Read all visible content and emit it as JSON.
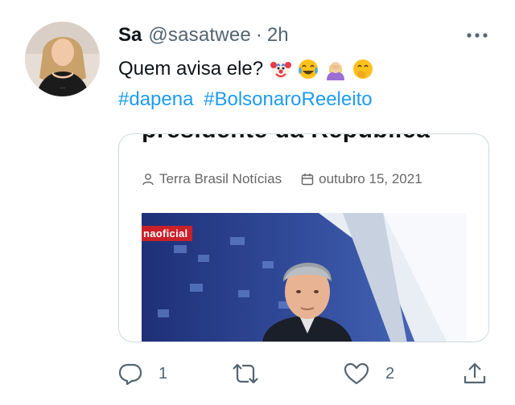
{
  "tweet": {
    "author_name": "Sa",
    "handle": "@sasatwee",
    "separator": "·",
    "time": "2h",
    "text": "Quem avisa ele?",
    "emojis": [
      "clown-face",
      "face-with-tears-of-joy",
      "person-facepalming",
      "face-with-hand-over-mouth"
    ],
    "hashtags": [
      "#dapena",
      "#BolsonaroReeleito"
    ]
  },
  "card": {
    "headline": "presidente da República",
    "source": "Terra Brasil Notícias",
    "date": "outubro 15, 2021",
    "tv_label": "naoficial"
  },
  "actions": {
    "reply_count": "1",
    "retweet_count": "",
    "like_count": "2"
  },
  "colors": {
    "hashtag": "#1d9bf0",
    "secondary_text": "#536471",
    "card_border": "#cfd9de"
  }
}
